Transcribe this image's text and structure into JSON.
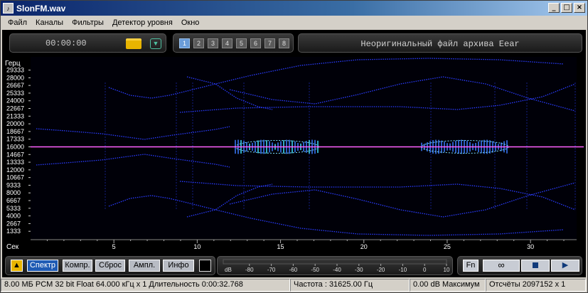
{
  "window": {
    "title": "SlonFM.wav",
    "app_icon": "app-icon",
    "controls": [
      "minimize",
      "maximize",
      "close"
    ]
  },
  "menu": [
    "Файл",
    "Каналы",
    "Фильтры",
    "Детектор уровня",
    "Окно"
  ],
  "toolbar": {
    "time": "00:00:00",
    "folder_icon": "folder-icon",
    "dropdown_icon": "chevron-down-icon",
    "channels": [
      "1",
      "2",
      "3",
      "4",
      "5",
      "6",
      "7",
      "8"
    ],
    "active_channel": "1",
    "info": "Неоригинальный файл архива Eear"
  },
  "spectrogram": {
    "y_title": "Герц",
    "x_title": "Сек",
    "y_ticks": [
      "29333",
      "28000",
      "26667",
      "25333",
      "24000",
      "22667",
      "21333",
      "20000",
      "18667",
      "17333",
      "16000",
      "14667",
      "13333",
      "12000",
      "10667",
      "9333",
      "8000",
      "6667",
      "5333",
      "4000",
      "2667",
      "1333"
    ],
    "x_ticks": [
      "5",
      "10",
      "15",
      "20",
      "25",
      "30"
    ],
    "x_range": [
      0,
      32.768
    ],
    "y_range": [
      0,
      31625
    ],
    "marker_hz": 16000,
    "marker_color": "#ff60ff"
  },
  "bottom": {
    "level_icon": "level-meter-icon",
    "buttons": [
      "Спектр",
      "Компр.",
      "Сброс",
      "Ампл.",
      "Инфо"
    ],
    "active_button": "Спектр",
    "db_label": "dB",
    "db_ticks": [
      "-80",
      "-70",
      "-60",
      "-50",
      "-40",
      "-30",
      "-20",
      "-10",
      "0",
      "10"
    ],
    "fn_label": "Fn",
    "loop_icon": "loop-icon",
    "stop_icon": "stop-icon",
    "play_icon": "play-icon"
  },
  "status": [
    "8.00 МБ PCM 32 bit Float 64.000 кГц x 1  Длительность 0:00:32.768",
    "Частота : 31625.00 Гц",
    "0.00 dB Максимум",
    "Отсчёты 2097152 x 1"
  ]
}
